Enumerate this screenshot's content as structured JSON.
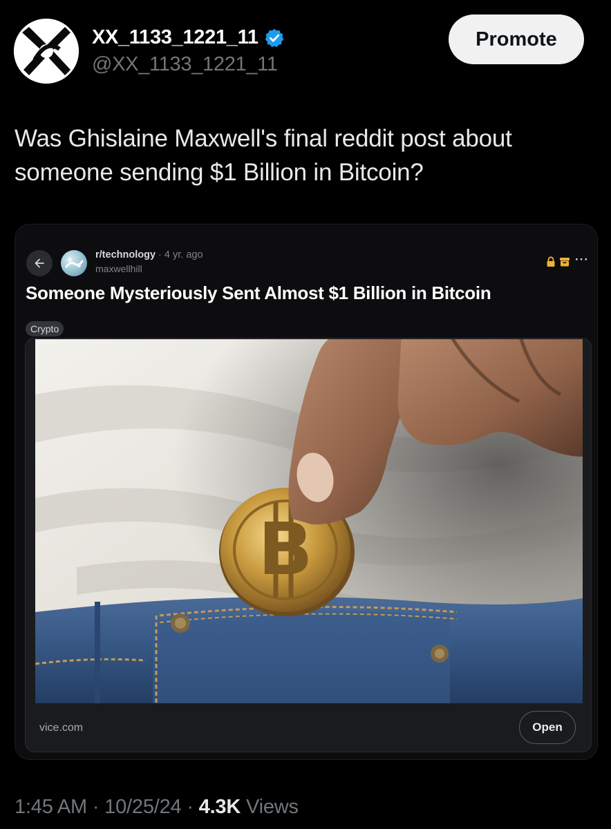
{
  "author": {
    "display_name": "XX_1133_1221_11",
    "handle": "@XX_1133_1221_11",
    "verified_icon": "verified-badge-icon",
    "avatar_icon": "avatar-logo-icon"
  },
  "header": {
    "promote_label": "Promote"
  },
  "tweet": {
    "text": "Was Ghislaine Maxwell's final reddit post about someone sending $1 Billion in Bitcoin?"
  },
  "embedded_post": {
    "back_icon": "back-arrow-icon",
    "subreddit": "r/technology",
    "separator": "·",
    "age": "4 yr. ago",
    "user": "maxwellhill",
    "title": "Someone Mysteriously Sent Almost $1 Billion in Bitcoin",
    "flair": "Crypto",
    "status_icons": [
      "lock-icon",
      "archive-icon",
      "more-icon"
    ],
    "more_label": "···",
    "link": {
      "domain": "vice.com",
      "open_label": "Open",
      "image_description_icon": "bitcoin-coin-in-jeans-pocket-image"
    }
  },
  "meta": {
    "time": "1:45 AM",
    "sep1": " · ",
    "date": "10/25/24",
    "sep2": " · ",
    "views_count": "4.3K",
    "views_label": " Views"
  },
  "colors": {
    "background": "#000000",
    "text_primary": "#e7e9ea",
    "text_secondary": "#71767b",
    "verified_blue": "#1d9bf0",
    "promote_bg": "#f1f1f1",
    "card_bg": "#0d0d0f",
    "flair_bg": "#33353a",
    "coin_gold": "#c9a04a",
    "denim": "#3d5a86"
  }
}
